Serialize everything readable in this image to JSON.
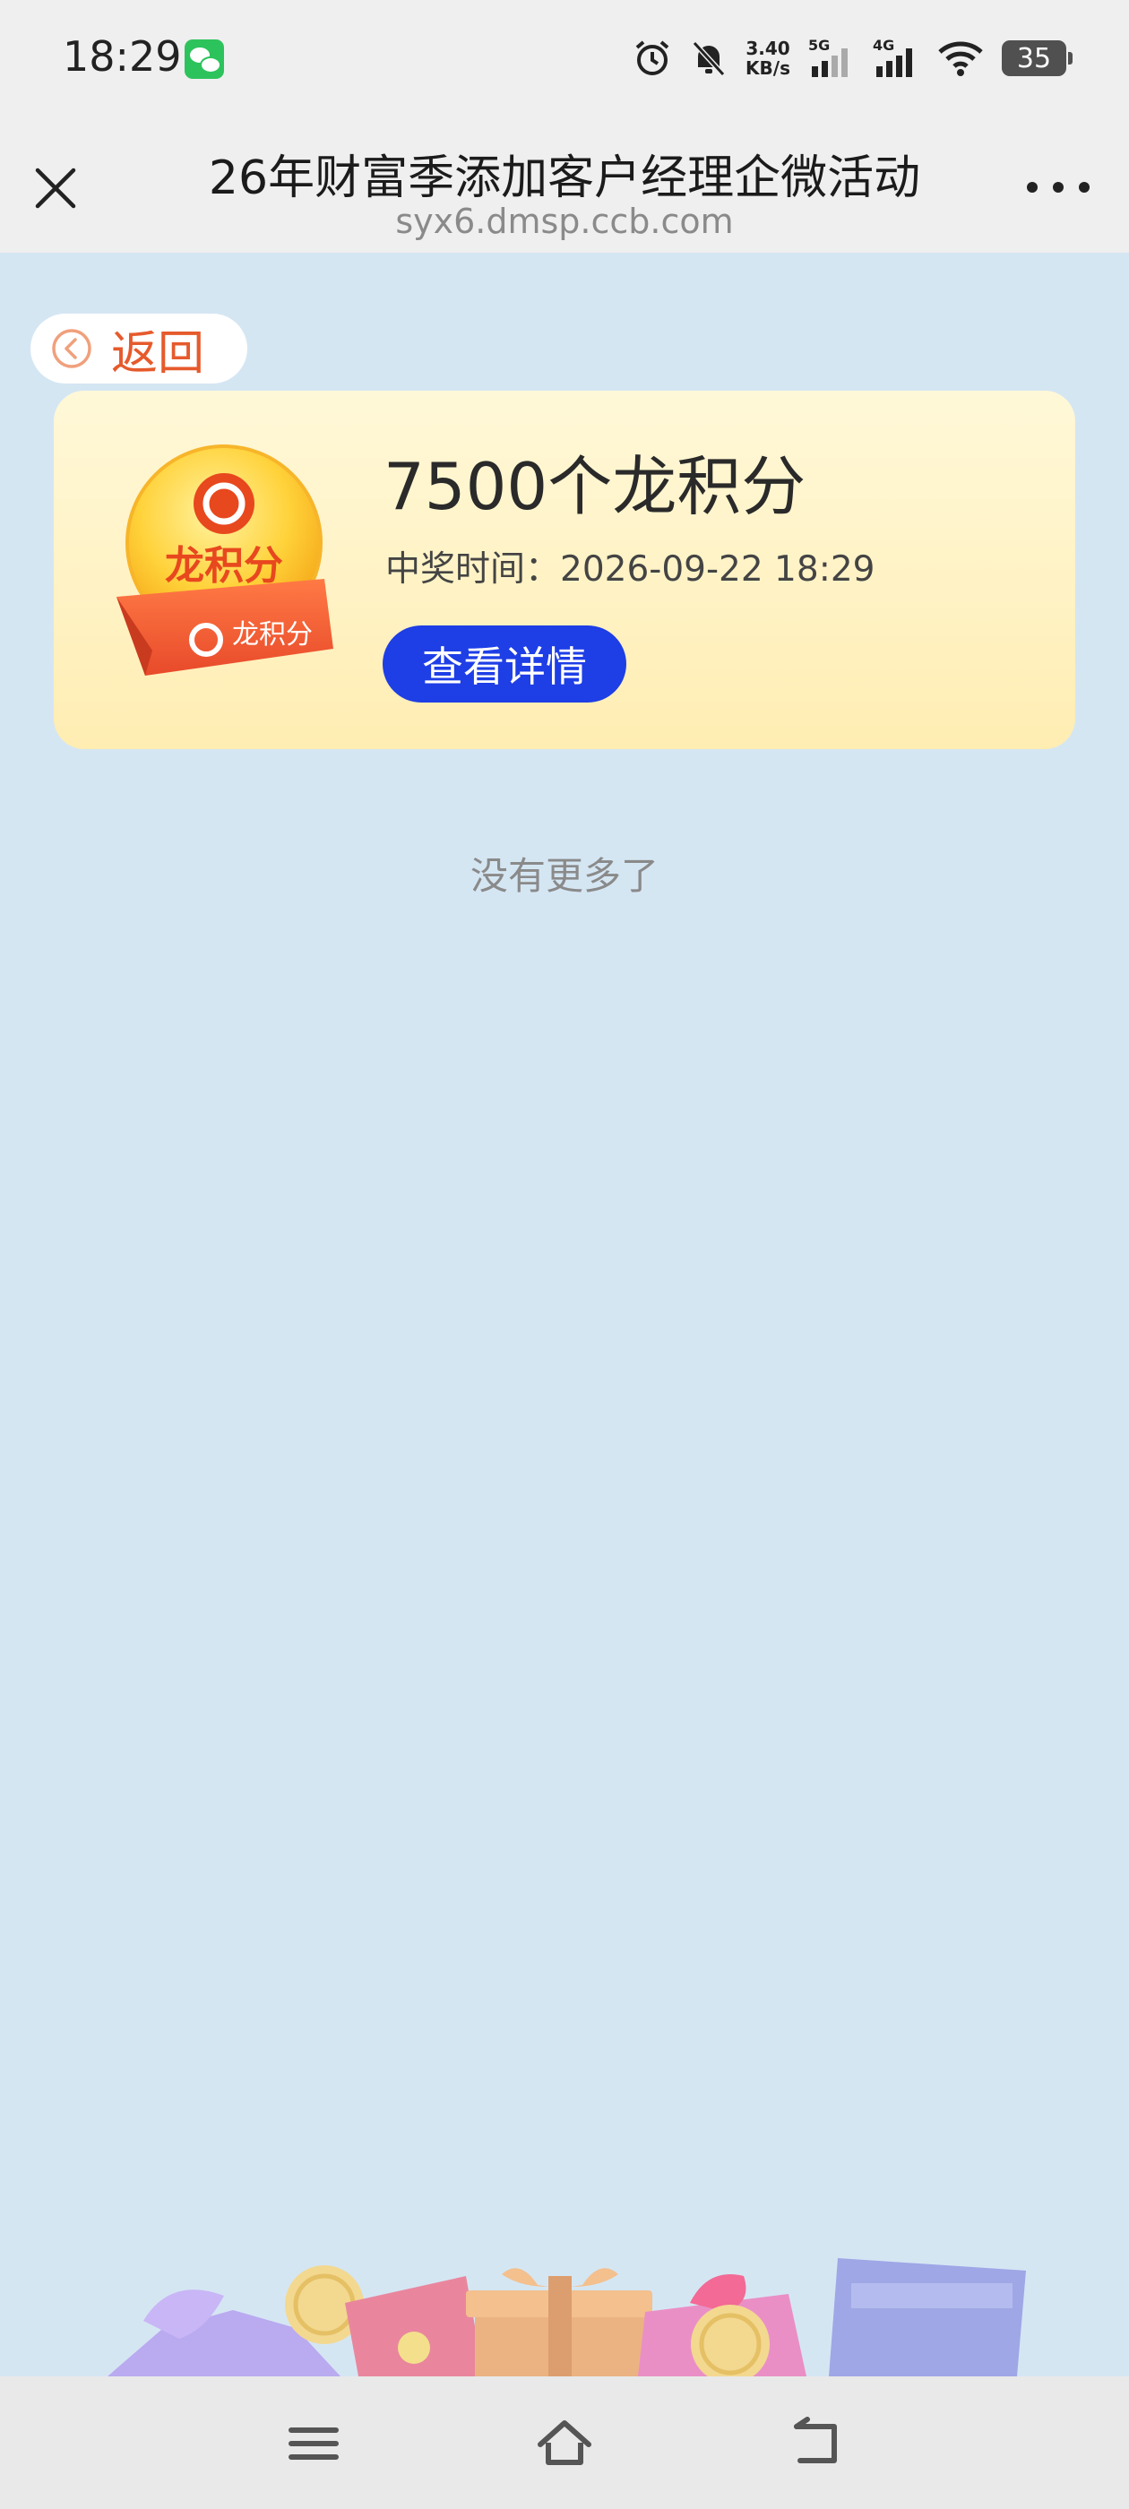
{
  "status_bar": {
    "time": "18:29",
    "net_speed_value": "3.40",
    "net_speed_unit": "KB/s",
    "sim1_label": "5G",
    "sim2_label": "4G",
    "battery_level": "35",
    "icons": [
      "wechat-icon",
      "alarm-icon",
      "mute-bell-icon",
      "signal-icon",
      "wifi-icon",
      "battery-icon"
    ]
  },
  "titlebar": {
    "title": "26年财富季添加客户经理企微活动",
    "url": "syx6.dmsp.ccb.com"
  },
  "back_button": {
    "label": "返回"
  },
  "prize": {
    "name": "7500个龙积分",
    "time_label": "中奖时间：",
    "time_value": "2026-09-22 18:29",
    "detail_button": "查看详情",
    "badge_text": "龙积分"
  },
  "list_end_text": "没有更多了",
  "colors": {
    "page_bg": "#d5e6f3",
    "accent_blue": "#1e3ee6",
    "back_orange": "#e65a2c",
    "card_yellow": "#fff4c8"
  }
}
